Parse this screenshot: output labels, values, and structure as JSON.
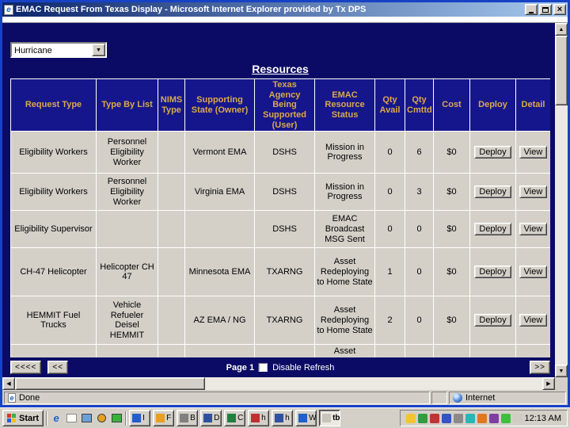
{
  "window": {
    "title": "EMAC Request From Texas Display - Microsoft Internet Explorer provided by Tx DPS"
  },
  "filter": {
    "value": "Hurricane"
  },
  "page": {
    "title": "Resources"
  },
  "table": {
    "headers": [
      "Request Type",
      "Type By List",
      "NIMS Type",
      "Supporting State (Owner)",
      "Texas Agency Being Supported (User)",
      "EMAC Resource Status",
      "Qty Avail",
      "Qty Cmttd",
      "Cost",
      "Deploy",
      "Detail"
    ],
    "deploy_label": "Deploy",
    "view_label": "View",
    "rows": [
      {
        "request_type": "Eligibility Workers",
        "type_by_list": "Personnel Eligibility Worker",
        "nims_type": "",
        "supporting_state": "Vermont EMA",
        "texas_agency": "DSHS",
        "status": "Mission in Progress",
        "qty_avail": "0",
        "qty_cmttd": "6",
        "cost": "$0"
      },
      {
        "request_type": "Eligibility Workers",
        "type_by_list": "Personnel Eligibility Worker",
        "nims_type": "",
        "supporting_state": "Virginia EMA",
        "texas_agency": "DSHS",
        "status": "Mission in Progress",
        "qty_avail": "0",
        "qty_cmttd": "3",
        "cost": "$0"
      },
      {
        "request_type": "Eligibility Supervisor",
        "type_by_list": "",
        "nims_type": "",
        "supporting_state": "",
        "texas_agency": "DSHS",
        "status": "EMAC Broadcast MSG Sent",
        "qty_avail": "0",
        "qty_cmttd": "0",
        "cost": "$0"
      },
      {
        "request_type": "CH-47 Helicopter",
        "type_by_list": "Helicopter CH 47",
        "nims_type": "",
        "supporting_state": "Minnesota EMA",
        "texas_agency": "TXARNG",
        "status": "Asset Redeploying to Home State",
        "qty_avail": "1",
        "qty_cmttd": "0",
        "cost": "$0"
      },
      {
        "request_type": "HEMMIT Fuel Trucks",
        "type_by_list": "Vehicle Refueler Deisel HEMMIT",
        "nims_type": "",
        "supporting_state": "AZ EMA / NG",
        "texas_agency": "TXARNG",
        "status": "Asset Redeploying to Home State",
        "qty_avail": "2",
        "qty_cmttd": "0",
        "cost": "$0"
      },
      {
        "request_type": "",
        "type_by_list": "",
        "nims_type": "",
        "supporting_state": "",
        "texas_agency": "",
        "status": "Asset",
        "qty_avail": "",
        "qty_cmttd": "",
        "cost": ""
      }
    ]
  },
  "pagination": {
    "first_label": "<<<<",
    "prev_label": "<<",
    "page_label": "Page 1",
    "disable_refresh_label": "Disable Refresh",
    "next_label": ">>"
  },
  "status_bar": {
    "message": "Done",
    "zone": "Internet"
  },
  "taskbar": {
    "start_label": "Start",
    "clock": "12:13 AM",
    "task_buttons": [
      {
        "label": "I"
      },
      {
        "label": "F"
      },
      {
        "label": "B"
      },
      {
        "label": "D"
      },
      {
        "label": "C"
      },
      {
        "label": "h"
      },
      {
        "label": "h"
      },
      {
        "label": "W"
      },
      {
        "label": "tb"
      }
    ]
  },
  "colors": {
    "page_background": "#0b0b66",
    "table_header_background": "#16168c",
    "table_header_text": "#d8a94a",
    "cell_background": "#d4d0c8",
    "titlebar_gradient_start": "#0a246a",
    "titlebar_gradient_end": "#a6caf0"
  }
}
